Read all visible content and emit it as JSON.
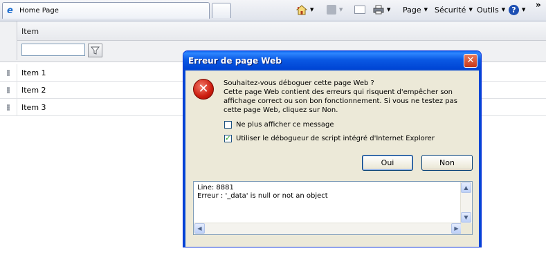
{
  "browser": {
    "tab_title": "Home Page",
    "toolbar": {
      "page_label": "Page",
      "security_label": "Sécurité",
      "tools_label": "Outils",
      "overflow_glyph": "»",
      "help_glyph": "?"
    }
  },
  "grid": {
    "column_header": "Item",
    "filter_value": "",
    "rows": [
      "Item 1",
      "Item 2",
      "Item 3"
    ]
  },
  "dialog": {
    "title": "Erreur de page Web",
    "close_glyph": "✕",
    "error_glyph": "✕",
    "question": "Souhaitez-vous déboguer cette page Web ?",
    "message": "Cette page Web contient des erreurs qui risquent d'empêcher son affichage correct ou son bon fonctionnement. Si vous ne testez pas cette page Web, cliquez sur Non.",
    "checkbox_dont_show": {
      "label": "Ne plus afficher ce message",
      "checked": false
    },
    "checkbox_use_debugger": {
      "label": "Utiliser le débogueur de script intégré d'Internet Explorer",
      "checked": true
    },
    "yes_button": "Oui",
    "no_button": "Non",
    "details_line1": "Line: 8881",
    "details_line2": "Erreur : '_data' is null or not an object"
  },
  "colors": {
    "dialog_title_blue": "#0046d5",
    "close_red": "#c7381a",
    "dialog_face": "#ece9d8"
  }
}
